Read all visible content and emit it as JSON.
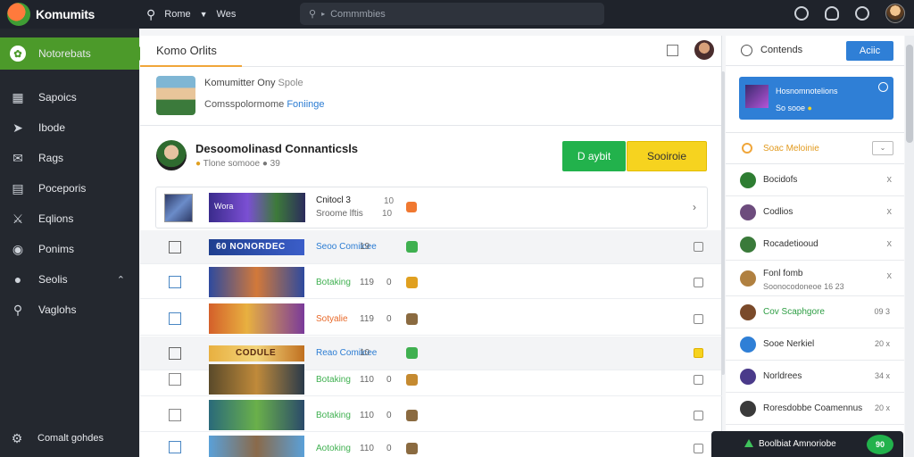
{
  "app": {
    "name": "Komumits"
  },
  "topbar": {
    "nav_item": "Rome",
    "nav_item2": "Wes",
    "search_placeholder": "Commmbies"
  },
  "sidebar": {
    "items": [
      {
        "label": "Notorebats",
        "icon": "leaf-icon",
        "active": true
      },
      {
        "label": "Sapoics",
        "icon": "grid-icon"
      },
      {
        "label": "Ibode",
        "icon": "rocket-icon"
      },
      {
        "label": "Rags",
        "icon": "mail-icon"
      },
      {
        "label": "Poceporis",
        "icon": "list-icon"
      },
      {
        "label": "Eqlions",
        "icon": "sword-icon"
      },
      {
        "label": "Ponims",
        "icon": "globe-icon"
      },
      {
        "label": "Seolis",
        "icon": "chat-icon"
      },
      {
        "label": "Vaglohs",
        "icon": "search-icon"
      }
    ],
    "bottom_label": "Comalt gohdes"
  },
  "main": {
    "title": "Komo Orlits",
    "profile": {
      "name": "Komumitter Ony",
      "name_suffix": "Spole",
      "sub": "Comsspolormome",
      "sub_link": "Foniinge"
    },
    "group": {
      "title": "Desoomolinasd Connanticsls",
      "meta": "Tlone somooe",
      "meta_count": "39",
      "btn_green": "D aybit",
      "btn_yellow": "Sooiroie"
    },
    "featured": {
      "banner_text": "Wora",
      "title": "Cnitocl 3",
      "sub": "Sroome lftis",
      "n1": "10",
      "n2": "10"
    },
    "rows": [
      {
        "thumb": "60 NONORDEC",
        "label": "Seoo Comiicee",
        "label_color": "#2b7cd3",
        "n1": "19",
        "n2": "",
        "icon_color": "#3fb050",
        "alt": true
      },
      {
        "thumb": "",
        "label": "Botaking",
        "label_color": "#3fb050",
        "n1": "119",
        "n2": "0",
        "icon_color": "#e0a020",
        "alt": false
      },
      {
        "thumb": "",
        "label": "Sotyalie",
        "label_color": "#e86a2a",
        "n1": "119",
        "n2": "0",
        "icon_color": "#8a6a40",
        "alt": false
      },
      {
        "thumb": "CODULE",
        "label": "Reao Comiicee",
        "label_color": "#2b7cd3",
        "n1": "10",
        "n2": "",
        "icon_color": "#3fb050",
        "alt": true
      },
      {
        "thumb": "",
        "label": "Botaking",
        "label_color": "#3fb050",
        "n1": "110",
        "n2": "0",
        "icon_color": "#c58a30",
        "alt": false
      },
      {
        "thumb": "",
        "label": "Botaking",
        "label_color": "#3fb050",
        "n1": "110",
        "n2": "0",
        "icon_color": "#8a6a40",
        "alt": false
      },
      {
        "thumb": "",
        "label": "Aotoking",
        "label_color": "#3fb050",
        "n1": "110",
        "n2": "0",
        "icon_color": "#8a6a40",
        "alt": false
      }
    ]
  },
  "right": {
    "title": "Contends",
    "button": "Aciic",
    "notification": {
      "line1": "Hosnomnotelions",
      "line2": "So sooe"
    },
    "search_text": "Soac Meloinie",
    "friends": [
      {
        "name": "Bocidofs",
        "av": "#2e7d32",
        "right": "x"
      },
      {
        "name": "Codlios",
        "av": "#6d4c7d",
        "right": "x"
      },
      {
        "name": "Rocadetiooud",
        "av": "#3a7a3a",
        "right": "x"
      },
      {
        "name": "Fonl fomb",
        "sub": "Soonocodoneoe 16 23",
        "av": "#b08040",
        "right": "x"
      },
      {
        "name": "Cov Scaphgore",
        "name_color": "#2e9e44",
        "av": "#7a4a2a",
        "right": "09 3"
      },
      {
        "name": "Sooe Nerkiel",
        "av": "#2f7fd6",
        "right": "20 x"
      },
      {
        "name": "Norldrees",
        "av": "#4a3a8a",
        "right": "34 x"
      },
      {
        "name": "Roresdobbe Coamennus",
        "av": "#3a3a3a",
        "right": "20 x"
      }
    ]
  },
  "chat": {
    "label": "Boolbiat Amnoriobe",
    "badge": "90"
  },
  "colors": {
    "accent_green": "#4c9a2a",
    "accent_blue": "#2f7fd6",
    "accent_yellow": "#f6d31f",
    "dark": "#1f232b"
  }
}
